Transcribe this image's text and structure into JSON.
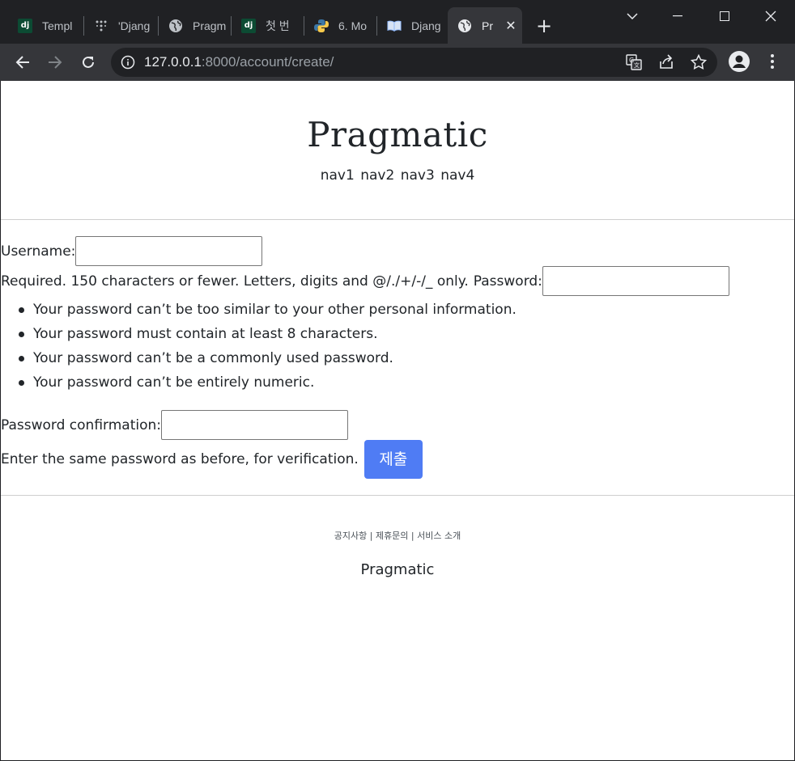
{
  "browser": {
    "tabs": [
      {
        "title": "Templ",
        "favicon": "django-icon"
      },
      {
        "title": "'Djang",
        "favicon": "dots-icon"
      },
      {
        "title": "Pragm",
        "favicon": "globe-icon"
      },
      {
        "title": "첫 번",
        "favicon": "django-icon"
      },
      {
        "title": "6. Mo",
        "favicon": "python-icon"
      },
      {
        "title": "Djang",
        "favicon": "book-icon"
      },
      {
        "title": "Pr",
        "favicon": "globe-icon",
        "active": true
      }
    ],
    "new_tab": "+",
    "address": {
      "host": "127.0.0.1",
      "rest": ":8000/account/create/"
    }
  },
  "page": {
    "brand": "Pragmatic",
    "nav": [
      "nav1",
      "nav2",
      "nav3",
      "nav4"
    ],
    "form": {
      "username_label": "Username:",
      "username_help": "Required. 150 characters or fewer. Letters, digits and @/./+/-/_ only.",
      "password_label": "Password:",
      "password_rules": [
        "Your password can’t be too similar to your other personal information.",
        "Your password must contain at least 8 characters.",
        "Your password can’t be a commonly used password.",
        "Your password can’t be entirely numeric."
      ],
      "confirm_label": "Password confirmation:",
      "confirm_help": "Enter the same password as before, for verification.",
      "submit_label": "제출"
    },
    "footer": {
      "links": "공지사항 | 제휴문의 | 서비스 소개",
      "brand": "Pragmatic"
    }
  },
  "colors": {
    "submit": "#4f7cf4",
    "chrome_dark": "#202124",
    "toolbar": "#35363a"
  }
}
